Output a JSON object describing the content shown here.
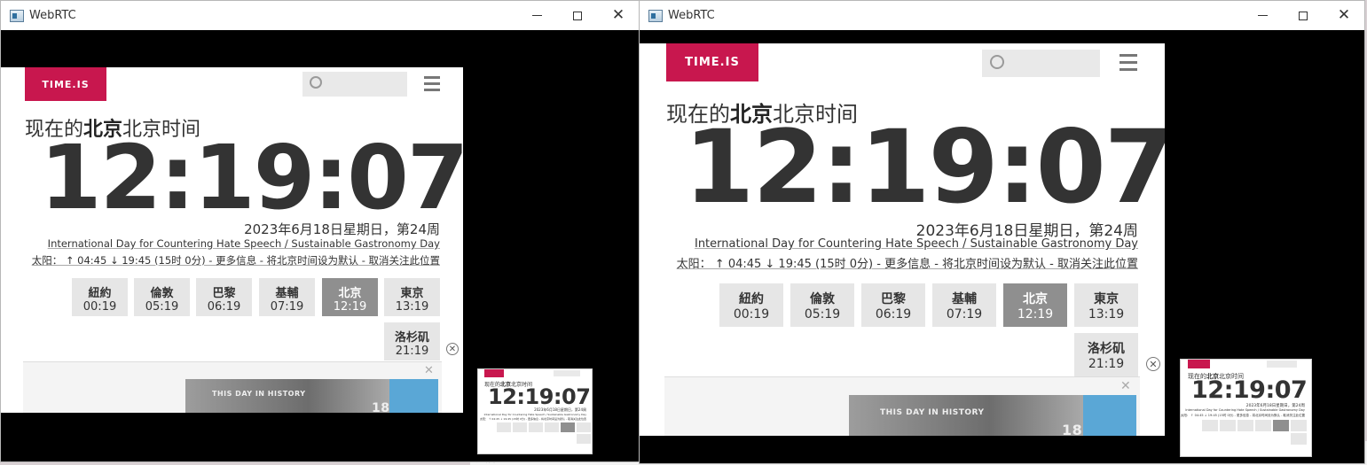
{
  "app": {
    "title": "WebRTC"
  },
  "window_controls": {
    "minimize": "minimize",
    "maximize": "maximize",
    "close": "close"
  },
  "site": {
    "logo": "TIME.IS",
    "headline_prefix": "现在的",
    "headline_bold": "北京",
    "headline_suffix": "北京时间",
    "time": "12:19:07",
    "date": "2023年6月18日星期日，第24周",
    "day_events": "International Day for Countering Hate Speech / Sustainable Gastronomy Day",
    "sun_info": "太阳： ↑ 04:45 ↓ 19:45 (15时 0分) - 更多信息 - 将北京时间设为默认 - 取消关注此位置",
    "cities": [
      {
        "name": "紐約",
        "time": "00:19",
        "active": false
      },
      {
        "name": "倫敦",
        "time": "05:19",
        "active": false
      },
      {
        "name": "巴黎",
        "time": "06:19",
        "active": false
      },
      {
        "name": "基輔",
        "time": "07:19",
        "active": false
      },
      {
        "name": "北京",
        "time": "12:19",
        "active": true
      },
      {
        "name": "東京",
        "time": "13:19",
        "active": false
      },
      {
        "name": "洛杉矶",
        "time": "21:19",
        "active": false
      }
    ],
    "ad": {
      "label": "THIS DAY IN HISTORY",
      "number": "18",
      "close_symbol": "⊗",
      "x_symbol": "✕"
    }
  },
  "desktop_strip": {
    "partial_text": "太阳： ↑ 04:45 ↓ 19:45"
  },
  "colors": {
    "brand": "#c8174e",
    "active_city": "#8f8f8f",
    "city_bg": "#e6e6e6"
  }
}
